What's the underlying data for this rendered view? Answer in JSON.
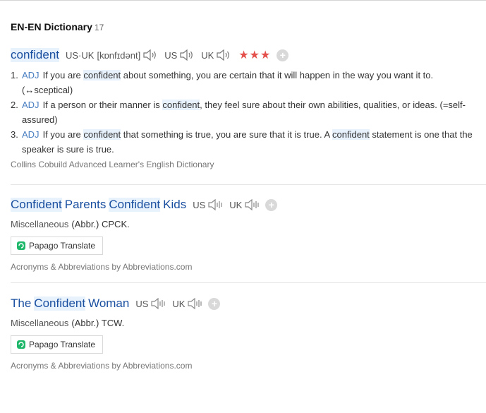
{
  "section": {
    "title": "EN-EN Dictionary",
    "count": "17"
  },
  "entry1": {
    "headword": "confident",
    "us_uk_label": "US·UK",
    "ipa": "[kɒnfɪdənt]",
    "us_label": "US",
    "uk_label": "UK",
    "stars": "★★★",
    "plus": "+",
    "senses": [
      {
        "num": "1.",
        "pos": "ADJ",
        "pre": "If you are ",
        "hl": "confident",
        "post": " about something, you are certain that it will happen in the way you want it to. (↔sceptical)"
      },
      {
        "num": "2.",
        "pos": "ADJ",
        "pre": "If a person or their manner is ",
        "hl": "confident",
        "post": ", they feel sure about their own abilities, qualities, or ideas. (=self-assured)"
      },
      {
        "num": "3.",
        "pos": "ADJ",
        "pre": "If you are ",
        "hl": "confident",
        "mid": " that something is true, you are sure that it is true. A ",
        "hl2": "confident",
        "post": " statement is one that the speaker is sure is true."
      }
    ],
    "source": "Collins Cobuild Advanced Learner's English Dictionary"
  },
  "entry2": {
    "words": [
      "Confident",
      "Parents",
      "Confident",
      "Kids"
    ],
    "us_label": "US",
    "uk_label": "UK",
    "plus": "+",
    "category": "Miscellaneous",
    "abbr": "(Abbr.) CPCK.",
    "papago": "Papago Translate",
    "source": "Acronyms & Abbreviations by Abbreviations.com"
  },
  "entry3": {
    "words": [
      "The",
      "Confident",
      "Woman"
    ],
    "us_label": "US",
    "uk_label": "UK",
    "plus": "+",
    "category": "Miscellaneous",
    "abbr": "(Abbr.) TCW.",
    "papago": "Papago Translate",
    "source": "Acronyms & Abbreviations by Abbreviations.com"
  },
  "colors": {
    "headword": "#1a4fa0",
    "highlight": "#e8f2fc",
    "stars": "#e4504b",
    "pos": "#4a7fc1",
    "papago_green": "#1fb86b"
  }
}
